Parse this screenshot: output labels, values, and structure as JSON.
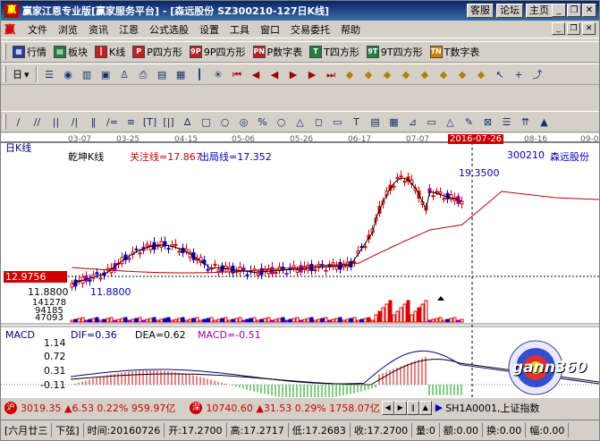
{
  "window": {
    "app_icon": "赢",
    "title": "赢家江恩专业版[赢家服务平台] - [森远股份  SZ300210-127日K线]",
    "links": [
      "客服",
      "论坛",
      "主页"
    ],
    "buttons": [
      "minimize-icon",
      "restore-icon",
      "close-icon"
    ]
  },
  "menu": {
    "logo": "赢",
    "items": [
      "文件",
      "浏览",
      "资讯",
      "江恩",
      "公式选股",
      "设置",
      "工具",
      "窗口",
      "交易委托",
      "帮助"
    ]
  },
  "toolbar1": {
    "items": [
      {
        "label": "行情",
        "icon": "grid-icon"
      },
      {
        "label": "板块",
        "icon": "blocks-icon"
      },
      {
        "label": "K线",
        "icon": "candle-icon"
      },
      {
        "label": "P四方形",
        "icon": "P"
      },
      {
        "label": "9P四方形",
        "icon": "9P"
      },
      {
        "label": "P数字表",
        "icon": "PN"
      },
      {
        "label": "T四方形",
        "icon": "T"
      },
      {
        "label": "9T四方形",
        "icon": "9T"
      },
      {
        "label": "T数字表",
        "icon": "TN"
      }
    ]
  },
  "toolbar2": {
    "period": "日",
    "icons": [
      "list-icon",
      "chart-icon",
      "stats-icon",
      "screen-icon",
      "people-icon",
      "print-icon",
      "open-icon",
      "save-icon",
      "indicator-icon",
      "zoom-icon",
      "goto-start-icon",
      "prev-icon",
      "step-back-icon",
      "step-forward-icon",
      "next-icon",
      "goto-end-icon",
      "diamond-prev-icon",
      "diamond-up-icon",
      "diamond-down-icon",
      "diamond-left-icon",
      "diamond-right-icon",
      "diamond-first-icon",
      "diamond-last-icon",
      "diamond-next-icon",
      "cursor-icon",
      "crosshair-icon",
      "line-tool-icon"
    ]
  },
  "toolbar3": {
    "tools": [
      "/",
      "//",
      "||",
      "/|",
      "‖",
      "/=",
      "≡",
      "[T]",
      "[|]",
      "∆",
      "□",
      "○",
      "◎",
      "%",
      "○",
      "△",
      "◻",
      "▭",
      "T",
      "▤",
      "▦",
      "⊿",
      "▭",
      "△",
      "✎",
      "⊠",
      "☰",
      "⇈",
      "▲"
    ]
  },
  "chart": {
    "period_label": "日K线",
    "indicator": "乾坤K线",
    "attention_line": "关注线=17.867",
    "exit_line": "出局线=17.352",
    "stock_code": "300210",
    "stock_name": "森远股份",
    "dates": [
      "03-07",
      "03-25",
      "04-15",
      "05-06",
      "05-26",
      "06-17",
      "07-07",
      "2016-07-26",
      "08-16",
      "09-0"
    ],
    "cursor_date": "2016-07-26",
    "cursor_price": "12.9756",
    "high_label": "19.3500",
    "low_label": "11.8800",
    "low_axis": "11.8800",
    "volume_ticks": [
      "141278",
      "94185",
      "47093"
    ],
    "macd": {
      "title": "MACD",
      "dif": "DIF=0.36",
      "dea": "DEA=0.62",
      "macd": "MACD=-0.51",
      "ticks": [
        "1.14",
        "0.72",
        "0.31",
        "-0.11"
      ]
    },
    "logo": "gann360",
    "colors": {
      "up": "#e00000",
      "down": "#0000c0",
      "alt": "#a000a0",
      "ma": "#000000",
      "line": "#c00000",
      "dif": "#000080",
      "dea": "#000000"
    }
  },
  "status1": {
    "sh_badge": "沪",
    "sh_values": "3019.35  ▲6.53  0.22%  959.97亿",
    "sz_badge": "深",
    "sz_values": "10740.60  ▲31.53  0.29%  1758.07亿",
    "ticker": "SH1A0001,上证指数"
  },
  "status2": {
    "cells": [
      "[六月廿三",
      "下弦]",
      "时间:20160726",
      "开:17.2700",
      "高:17.2717",
      "低:17.2683",
      "收:17.2700",
      "量:0",
      "额:0.00",
      "换:0.00",
      "幅:0.00"
    ]
  }
}
